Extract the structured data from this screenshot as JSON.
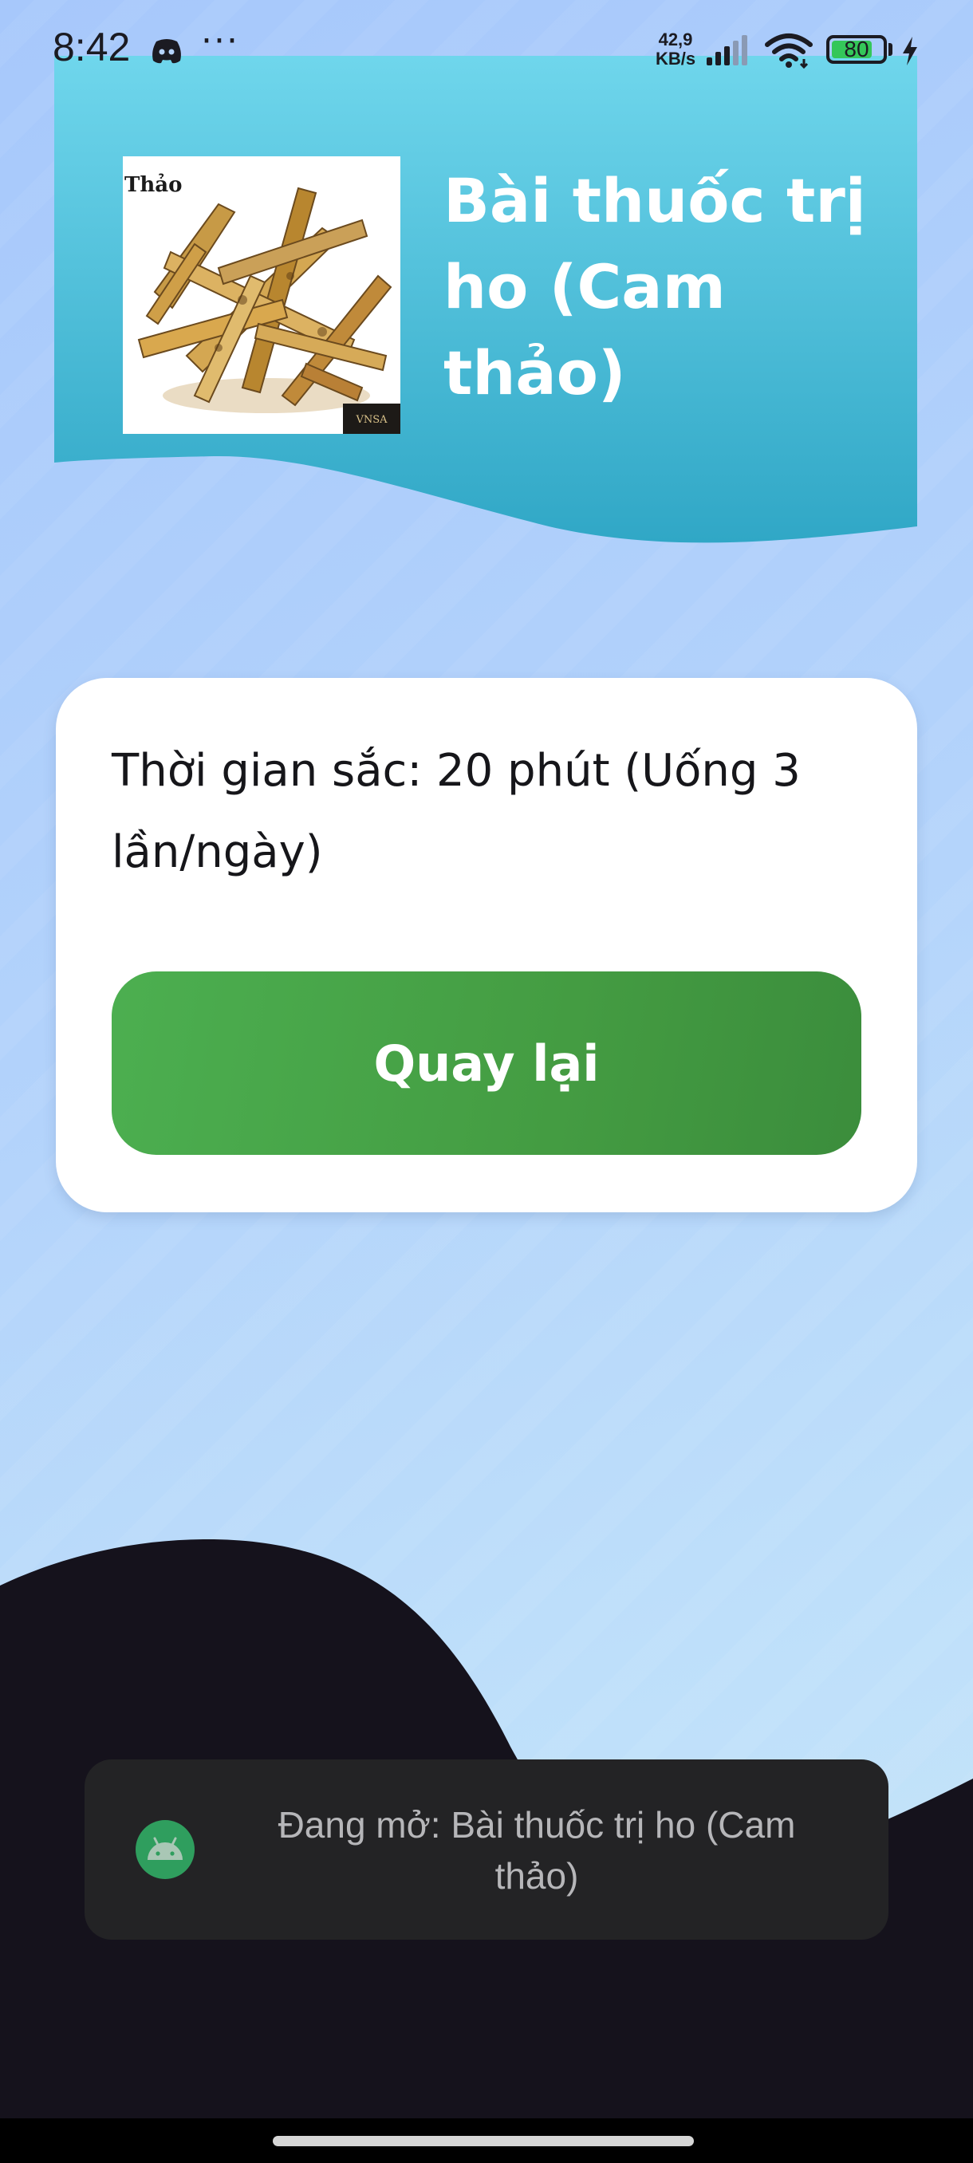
{
  "status_bar": {
    "time": "8:42",
    "more": "···",
    "speed_value": "42,9",
    "speed_unit": "KB/s",
    "battery": "80",
    "battery_level": 0.8
  },
  "header": {
    "title": "Bài thuốc trị ho (Cam thảo)",
    "image_label": "Thảo",
    "image_watermark": "VNSA"
  },
  "card": {
    "info": "Thời gian sắc: 20 phút (Uống 3 lần/ngày)",
    "back_label": "Quay lại"
  },
  "toast": {
    "message": "Đang mở: Bài thuốc trị ho (Cam thảo)"
  },
  "colors": {
    "header_top": "#6fd6ec",
    "header_bottom": "#30a7c6",
    "button_green": "#4caf50",
    "toast_bg": "#232325",
    "dark_wave": "#15121c",
    "android_icon_bg": "#3ddc84"
  }
}
